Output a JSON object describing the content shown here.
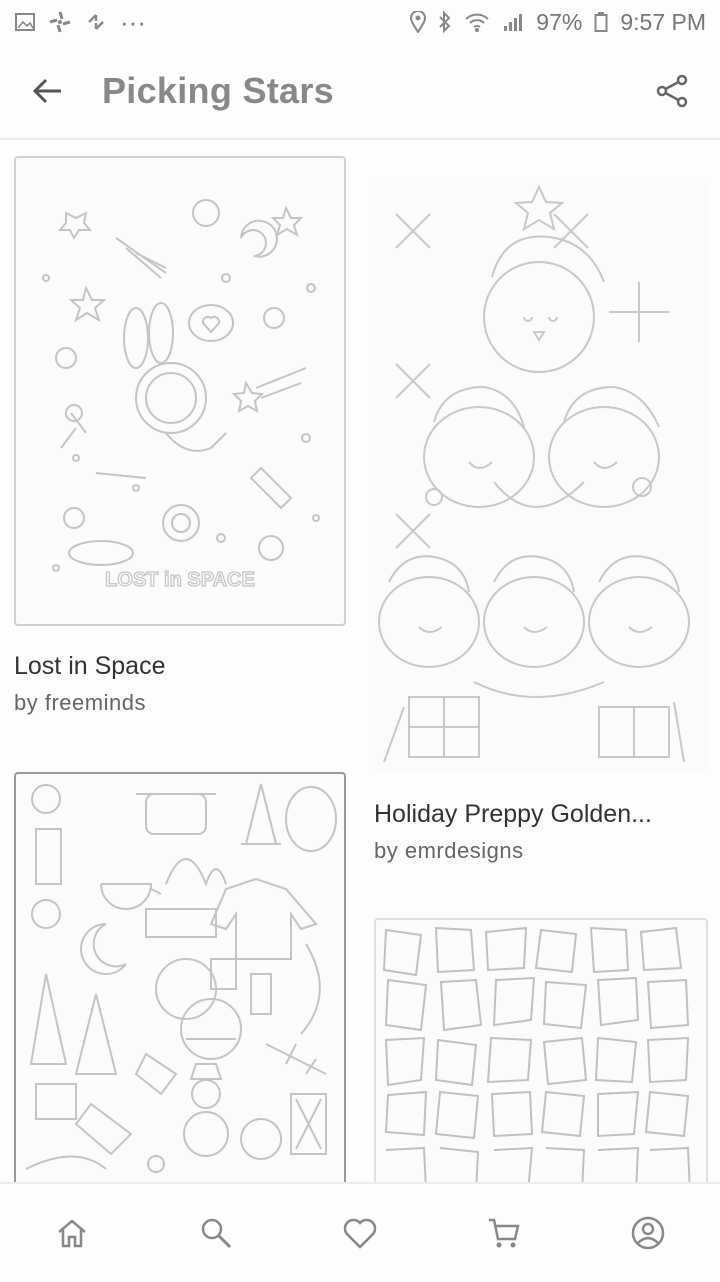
{
  "status_bar": {
    "battery": "97%",
    "time": "9:57 PM",
    "more": "···"
  },
  "header": {
    "title": "Picking Stars"
  },
  "cards": [
    {
      "title": "Lost in Space",
      "by": "by freeminds",
      "art_text": "LOST in SPACE"
    },
    {
      "title": "Holiday Preppy Golden...",
      "by": "by emrdesigns"
    },
    {
      "title": "",
      "by": ""
    },
    {
      "title": "",
      "by": ""
    }
  ],
  "nav": [
    "home",
    "search",
    "favorites",
    "cart",
    "profile"
  ],
  "icons": [
    "back-arrow-icon",
    "share-icon",
    "home-icon",
    "search-icon",
    "heart-icon",
    "cart-icon",
    "profile-icon"
  ]
}
